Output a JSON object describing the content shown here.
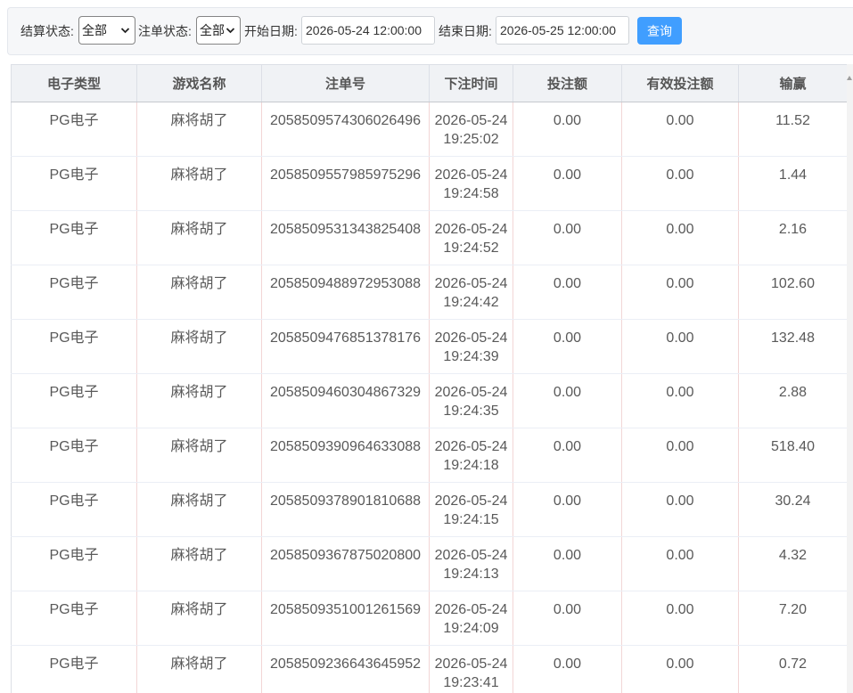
{
  "filters": {
    "settle_status": {
      "label": "结算状态:",
      "value": "全部",
      "icon": "chevron-down-icon"
    },
    "bet_status": {
      "label": "注单状态:",
      "value": "全部",
      "icon": "chevron-down-icon"
    },
    "start_date": {
      "label": "开始日期:",
      "value": "2026-05-24 12:00:00"
    },
    "end_date": {
      "label": "结束日期:",
      "value": "2026-05-25 12:00:00"
    },
    "query_label": "查询"
  },
  "table": {
    "columns": [
      "电子类型",
      "游戏名称",
      "注单号",
      "下注时间",
      "投注额",
      "有效投注额",
      "输赢"
    ],
    "rows": [
      {
        "type": "PG电子",
        "game": "麻将胡了",
        "bet_id": "2058509574306026496",
        "time": "2026-05-24 19:25:02",
        "bet": "0.00",
        "valid_bet": "0.00",
        "win_loss": "11.52"
      },
      {
        "type": "PG电子",
        "game": "麻将胡了",
        "bet_id": "2058509557985975296",
        "time": "2026-05-24 19:24:58",
        "bet": "0.00",
        "valid_bet": "0.00",
        "win_loss": "1.44"
      },
      {
        "type": "PG电子",
        "game": "麻将胡了",
        "bet_id": "2058509531343825408",
        "time": "2026-05-24 19:24:52",
        "bet": "0.00",
        "valid_bet": "0.00",
        "win_loss": "2.16"
      },
      {
        "type": "PG电子",
        "game": "麻将胡了",
        "bet_id": "2058509488972953088",
        "time": "2026-05-24 19:24:42",
        "bet": "0.00",
        "valid_bet": "0.00",
        "win_loss": "102.60"
      },
      {
        "type": "PG电子",
        "game": "麻将胡了",
        "bet_id": "2058509476851378176",
        "time": "2026-05-24 19:24:39",
        "bet": "0.00",
        "valid_bet": "0.00",
        "win_loss": "132.48"
      },
      {
        "type": "PG电子",
        "game": "麻将胡了",
        "bet_id": "2058509460304867329",
        "time": "2026-05-24 19:24:35",
        "bet": "0.00",
        "valid_bet": "0.00",
        "win_loss": "2.88"
      },
      {
        "type": "PG电子",
        "game": "麻将胡了",
        "bet_id": "2058509390964633088",
        "time": "2026-05-24 19:24:18",
        "bet": "0.00",
        "valid_bet": "0.00",
        "win_loss": "518.40"
      },
      {
        "type": "PG电子",
        "game": "麻将胡了",
        "bet_id": "2058509378901810688",
        "time": "2026-05-24 19:24:15",
        "bet": "0.00",
        "valid_bet": "0.00",
        "win_loss": "30.24"
      },
      {
        "type": "PG电子",
        "game": "麻将胡了",
        "bet_id": "2058509367875020800",
        "time": "2026-05-24 19:24:13",
        "bet": "0.00",
        "valid_bet": "0.00",
        "win_loss": "4.32"
      },
      {
        "type": "PG电子",
        "game": "麻将胡了",
        "bet_id": "2058509351001261569",
        "time": "2026-05-24 19:24:09",
        "bet": "0.00",
        "valid_bet": "0.00",
        "win_loss": "7.20"
      },
      {
        "type": "PG电子",
        "game": "麻将胡了",
        "bet_id": "2058509236643645952",
        "time": "2026-05-24 19:23:41",
        "bet": "0.00",
        "valid_bet": "0.00",
        "win_loss": "0.72"
      }
    ]
  },
  "theme": {
    "accent": "#409eff",
    "header_bg": "#f0f2f5"
  }
}
